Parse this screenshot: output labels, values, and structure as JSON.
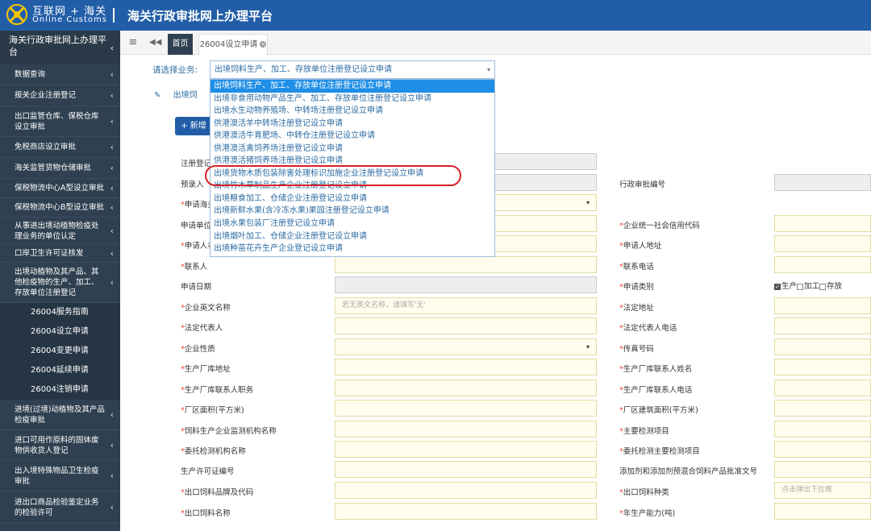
{
  "header": {
    "brand_line1": "互联网 + 海关",
    "brand_line2": "Online Customs",
    "title": "海关行政审批网上办理平台"
  },
  "sidebar": {
    "title": "海关行政审批网上办理平台",
    "items": [
      {
        "label": "数据查询",
        "h": 26
      },
      {
        "label": "报关企业注册登记",
        "h": 26
      },
      {
        "label": "出口监管仓库、保税仓库设立审批",
        "h": 38
      },
      {
        "label": "免税商店设立审批",
        "h": 26
      },
      {
        "label": "海关监管货物仓储审批",
        "h": 26
      },
      {
        "label": "保税物流中心A型设立审批",
        "h": 24
      },
      {
        "label": "保税物流中心B型设立审批",
        "h": 24
      },
      {
        "label": "从事进出境动植物检疫处理业务的单位认定",
        "h": 34
      },
      {
        "label": "口岸卫生许可证核发",
        "h": 22
      },
      {
        "label": "出境动植物及其产品、其他检疫物的生产、加工、存放单位注册登记",
        "h": 50
      }
    ],
    "subitems": [
      "26004服务指南",
      "26004设立申请",
      "26004变更申请",
      "26004延续申请",
      "26004注销申请"
    ],
    "items2": [
      {
        "label": "进境(过境)动植物及其产品检疫审批",
        "h": 38
      },
      {
        "label": "进口可用作原料的固体废物供收货人登记",
        "h": 38
      },
      {
        "label": "出入境特殊物品卫生检疫审批",
        "h": 38
      },
      {
        "label": "进出口商品检验鉴定业务的检验许可",
        "h": 40
      }
    ]
  },
  "tabs": {
    "home": "首页",
    "current": "26004设立申请"
  },
  "business": {
    "label": "请选择业务:",
    "selected": "出境饲料生产、加工、存放单位注册登记设立申请",
    "toolbar_text": "出境饲"
  },
  "buttons": {
    "add": "新增"
  },
  "dropdown": {
    "options": [
      "出境饲料生产、加工、存放单位注册登记设立申请",
      "出境非食用动物产品生产、加工、存放单位注册登记设立申请",
      "出境水生动物养殖场、中转场注册登记设立申请",
      "供港澳活羊中转场注册登记设立申请",
      "供港澳活牛育肥场、中转仓注册登记设立申请",
      "供港澳活禽饲养场注册登记设立申请",
      "供港澳活猪饲养场注册登记设立申请",
      "出境货物木质包装除害处理标识加施企业注册登记设立申请",
      "出境竹木草制品生产企业注册登记设立申请",
      "出境粮食加工、仓储企业注册登记设立申请",
      "出境新鲜水果(含冷冻水果)果园注册登记设立申请",
      "出境水果包装厂注册登记设立申请",
      "出境烟叶加工、仓储企业注册登记设立申请",
      "出境种苗花卉生产企业登记设立申请"
    ],
    "highlighted_index": 7
  },
  "form": {
    "left": [
      {
        "label": "注册登记",
        "req": false
      },
      {
        "label": "预录入",
        "req": false
      },
      {
        "label": "申请海关",
        "req": true
      },
      {
        "label": "申请单位",
        "req": false
      },
      {
        "label": "申请人名",
        "req": true
      },
      {
        "label": "联系人",
        "req": true
      },
      {
        "label": "申请日期",
        "req": false
      },
      {
        "label": "企业英文名称",
        "req": true
      },
      {
        "label": "法定代表人",
        "req": true
      },
      {
        "label": "企业性质",
        "req": true
      },
      {
        "label": "生产厂库地址",
        "req": true
      },
      {
        "label": "生产厂库联系人职务",
        "req": true
      },
      {
        "label": "厂区面积(平方米)",
        "req": true
      },
      {
        "label": "饲料生产企业监测机构名称",
        "req": true
      },
      {
        "label": "委托检测机构名称",
        "req": true
      },
      {
        "label": "生产许可证编号",
        "req": false
      },
      {
        "label": "出口饲料品牌及代码",
        "req": true
      },
      {
        "label": "出口饲料名称",
        "req": true
      }
    ],
    "right": [
      {
        "label": "行政审批编号",
        "req": false
      },
      {
        "label": "企业统一社会信用代码",
        "req": true
      },
      {
        "label": "申请人地址",
        "req": true
      },
      {
        "label": "联系电话",
        "req": true
      },
      {
        "label": "申请类别",
        "req": true
      },
      {
        "label": "法定地址",
        "req": true
      },
      {
        "label": "法定代表人电话",
        "req": true
      },
      {
        "label": "传真号码",
        "req": true
      },
      {
        "label": "生产厂库联系人姓名",
        "req": true
      },
      {
        "label": "生产厂库联系人电话",
        "req": true
      },
      {
        "label": "厂区建筑面积(平方米)",
        "req": true
      },
      {
        "label": "主要检测项目",
        "req": true
      },
      {
        "label": "委托检测主要检测项目",
        "req": true
      },
      {
        "label": "添加剂和添加剂预混合饲料产品批准文号",
        "req": false
      },
      {
        "label": "出口饲料种类",
        "req": true
      },
      {
        "label": "年生产能力(吨)",
        "req": true
      }
    ],
    "english_name_placeholder": "若无英文名称，请填写'无'",
    "feed_type_hint": "点击弹出下拉框",
    "apply_types": [
      "生产",
      "加工",
      "存放"
    ],
    "apply_type_checked": "生产"
  }
}
